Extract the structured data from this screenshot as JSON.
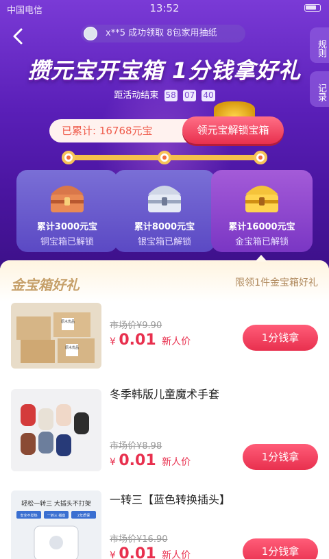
{
  "status_bar": {
    "carrier": "中国电信",
    "time": "13:52"
  },
  "ticker": {
    "user": "x**5",
    "message": "成功领取 8包家用抽纸"
  },
  "side_tabs": {
    "rules": "规则",
    "records": "记录"
  },
  "headline": "攒元宝开宝箱 1分钱拿好礼",
  "countdown": {
    "label": "距活动结束",
    "hours": "58",
    "minutes": "07",
    "seconds": "40"
  },
  "progress": {
    "accumulated": "已累计: 16768元宝",
    "unlock_button": "领元宝解锁宝箱"
  },
  "chests": [
    {
      "title": "累计3000元宝",
      "status": "铜宝箱已解锁"
    },
    {
      "title": "累计8000元宝",
      "status": "银宝箱已解锁"
    },
    {
      "title": "累计16000元宝",
      "status": "金宝箱已解锁"
    }
  ],
  "section": {
    "title": "金宝箱好礼",
    "subtitle": "限领1件金宝箱好礼"
  },
  "products": [
    {
      "name": "",
      "market_price": "市场价¥9.90",
      "currency": "¥",
      "price": "0.01",
      "tag": "新人价",
      "button": "1分钱拿"
    },
    {
      "name": "冬季韩版儿童魔术手套",
      "market_price": "市场价¥8.98",
      "currency": "¥",
      "price": "0.01",
      "tag": "新人价",
      "button": "1分钱拿"
    },
    {
      "name": "一转三【蓝色转换插头】",
      "market_price": "市场价¥16.90",
      "currency": "¥",
      "price": "0.01",
      "tag": "新人价",
      "button": "1分钱拿"
    }
  ],
  "product_thumb_text": {
    "box_label": "原木优品",
    "plug_heading": "轻松一转三 大插头不打架",
    "plug_tags": [
      "安全不发热",
      "一转三 插座",
      "2年质保"
    ]
  }
}
